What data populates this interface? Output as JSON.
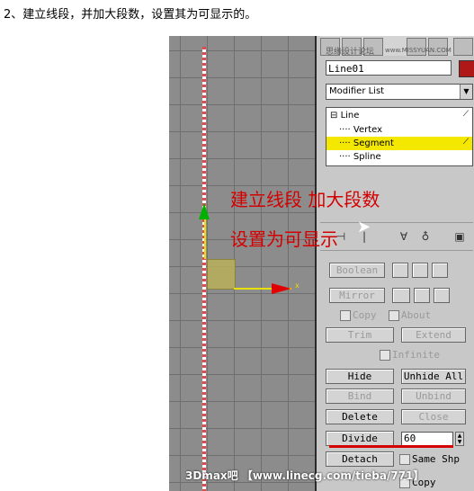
{
  "caption": "2、建立线段，并加大段数，设置其为可显示的。",
  "panel": {
    "watermark": "思缘设计论坛",
    "watermark_url": "www.MISSYUAN.COM",
    "object_name": "Line01",
    "object_color": "#b01818",
    "modifier_list_label": "Modifier List",
    "stack": {
      "root": "Line",
      "items": [
        "Vertex",
        "Segment",
        "Spline"
      ],
      "selected": "Segment"
    },
    "buttons": {
      "boolean": "Boolean",
      "mirror": "Mirror",
      "copy": "Copy",
      "about": "About",
      "trim": "Trim",
      "extend": "Extend",
      "infinite": "Infinite",
      "hide": "Hide",
      "unhide_all": "Unhide All",
      "bind": "Bind",
      "unbind": "Unbind",
      "delete": "Delete",
      "close": "Close",
      "divide": "Divide",
      "detach": "Detach",
      "same_shp": "Same Shp",
      "copy2": "Copy"
    },
    "divide_value": "60"
  },
  "overlay": {
    "line1": "建立线段  加大段数",
    "line2": "设置为可显示"
  },
  "footer": "3Dmax吧 【www.linecg.com/tieba/771】",
  "colors": {
    "highlight": "#f4e800",
    "annotation": "#d40000"
  }
}
